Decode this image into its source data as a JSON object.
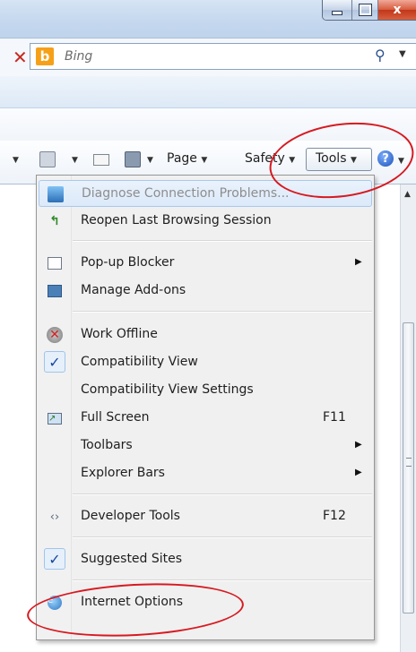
{
  "window": {
    "caption": {
      "min_icon": "minimize-icon",
      "max_icon": "maximize-icon",
      "close_label": "x"
    }
  },
  "search": {
    "provider": "Bing",
    "logo_letter": "b",
    "stop_label": "✕",
    "search_glyph": "⚲",
    "dropdown_glyph": "▼"
  },
  "command_bar": {
    "page_label": "Page",
    "safety_label": "Safety",
    "tools_label": "Tools",
    "help_glyph": "?",
    "arrow_glyph": "▼"
  },
  "tools_menu": {
    "items": [
      {
        "label": "Diagnose Connection Problems...",
        "icon": "network-diagnose-icon",
        "disabled": true
      },
      {
        "label": "Reopen Last Browsing Session",
        "icon": "reopen-session-icon"
      },
      {
        "label": "Pop-up Blocker",
        "icon": "popup-blocker-icon",
        "submenu": true
      },
      {
        "label": "Manage Add-ons",
        "icon": "addons-icon"
      },
      {
        "label": "Work Offline",
        "icon": "work-offline-icon"
      },
      {
        "label": "Compatibility View",
        "icon": "check-icon",
        "checked": true
      },
      {
        "label": "Compatibility View Settings"
      },
      {
        "label": "Full Screen",
        "icon": "full-screen-icon",
        "shortcut": "F11"
      },
      {
        "label": "Toolbars",
        "submenu": true
      },
      {
        "label": "Explorer Bars",
        "submenu": true
      },
      {
        "label": "Developer Tools",
        "icon": "developer-tools-icon",
        "shortcut": "F12"
      },
      {
        "label": "Suggested Sites",
        "icon": "check-icon",
        "checked": true
      },
      {
        "label": "Internet Options",
        "icon": "internet-options-icon"
      }
    ],
    "submenu_glyph": "▶",
    "check_glyph": "✓"
  },
  "colors": {
    "annotation": "#d71920",
    "highlight_border": "#a9c9ef",
    "disabled_text": "#8d8d8d"
  }
}
